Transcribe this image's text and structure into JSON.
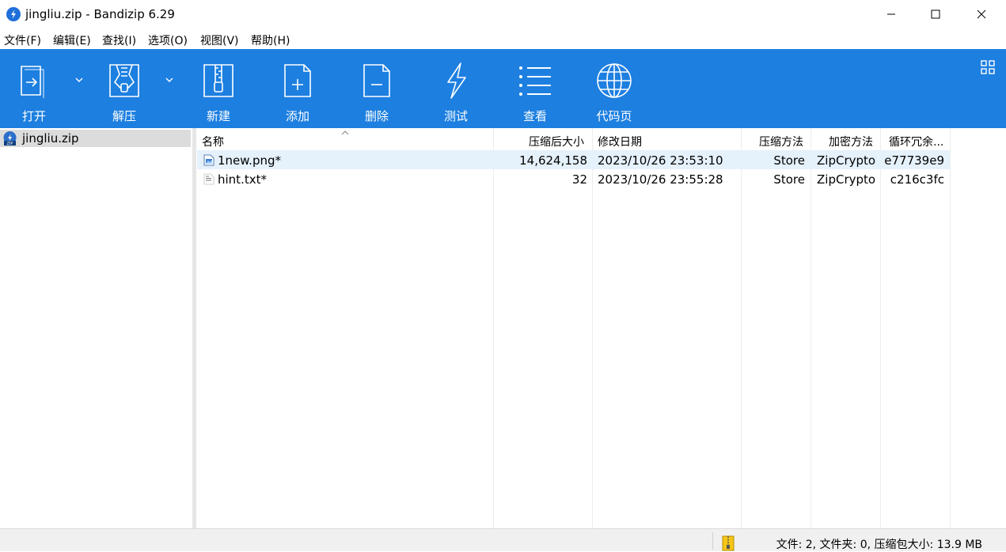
{
  "window": {
    "title": "jingliu.zip - Bandizip 6.29"
  },
  "menu": [
    "文件(F)",
    "编辑(E)",
    "查找(I)",
    "选项(O)",
    "视图(V)",
    "帮助(H)"
  ],
  "toolbar": {
    "open": "打开",
    "extract": "解压",
    "new": "新建",
    "add": "添加",
    "delete": "删除",
    "test": "测试",
    "view": "查看",
    "codepage": "代码页"
  },
  "tree": {
    "root": "jingliu.zip"
  },
  "columns": {
    "name": "名称",
    "packed_size": "压缩后大小",
    "modified": "修改日期",
    "method": "压缩方法",
    "encryption": "加密方法",
    "crc": "循环冗余..."
  },
  "files": [
    {
      "name": "1new.png*",
      "packed_size": "14,624,158",
      "modified": "2023/10/26 23:53:10",
      "method": "Store",
      "encryption": "ZipCrypto",
      "crc": "e77739e9",
      "selected": true
    },
    {
      "name": "hint.txt*",
      "packed_size": "32",
      "modified": "2023/10/26 23:55:28",
      "method": "Store",
      "encryption": "ZipCrypto",
      "crc": "c216c3fc",
      "selected": false
    }
  ],
  "status": {
    "text": "文件: 2, 文件夹: 0, 压缩包大小: 13.9 MB"
  },
  "colors": {
    "toolbar": "#1d7fe0",
    "selection": "#e5f1fb"
  }
}
